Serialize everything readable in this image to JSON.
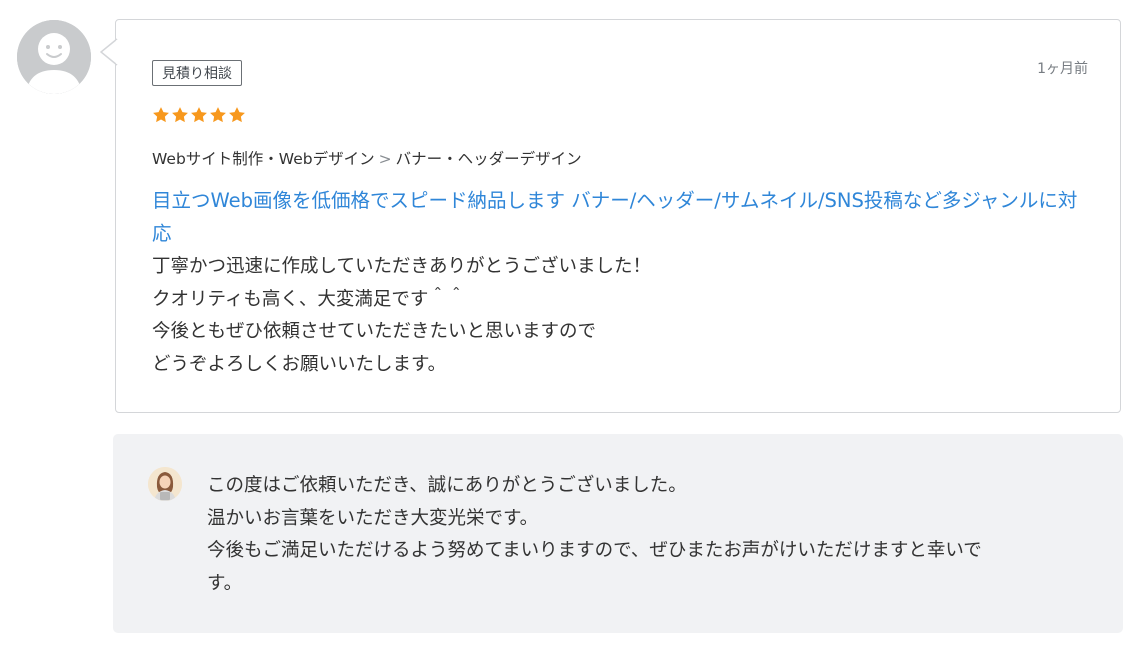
{
  "review": {
    "tag": "見積り相談",
    "date": "1ヶ月前",
    "rating": 5,
    "star_color": "#f7981d",
    "category": {
      "parent": "Webサイト制作・Webデザイン",
      "separator": ">",
      "child": "バナー・ヘッダーデザイン"
    },
    "service_title": "目立つWeb画像を低価格でスピード納品します バナー/ヘッダー/サムネイル/SNS投稿など多ジャンルに対応",
    "body_lines": [
      "丁寧かつ迅速に作成していただきありがとうございました！",
      "クオリティも高く、大変満足です＾＾",
      "今後ともぜひ依頼させていただきたいと思いますので",
      "どうぞよろしくお願いいたします。"
    ]
  },
  "reply": {
    "body_lines": [
      "この度はご依頼いただき、誠にありがとうございました。",
      "温かいお言葉をいただき大変光栄です。",
      "今後もご満足いただけるよう努めてまいりますので、ぜひまたお声がけいただけますと幸いで",
      "す。"
    ]
  },
  "colors": {
    "link": "#2f86d8",
    "reply_background": "#f1f2f4",
    "card_border": "#d4d6d9"
  },
  "icons": {
    "reviewer_avatar": "default-user-avatar-icon",
    "seller_avatar": "seller-avatar-icon",
    "star": "star-icon"
  }
}
